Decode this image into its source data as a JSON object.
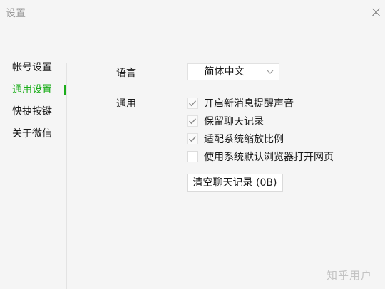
{
  "window": {
    "title": "设置"
  },
  "sidebar": {
    "items": [
      {
        "label": "帐号设置",
        "active": false
      },
      {
        "label": "通用设置",
        "active": true
      },
      {
        "label": "快捷按键",
        "active": false
      },
      {
        "label": "关于微信",
        "active": false
      }
    ]
  },
  "settings": {
    "language_label": "语言",
    "language_value": "简体中文",
    "general_label": "通用",
    "options": [
      {
        "label": "开启新消息提醒声音",
        "checked": true
      },
      {
        "label": "保留聊天记录",
        "checked": true
      },
      {
        "label": "适配系统缩放比例",
        "checked": true
      },
      {
        "label": "使用系统默认浏览器打开网页",
        "checked": false
      }
    ],
    "clear_button_label": "清空聊天记录 (0B)"
  },
  "watermark": "知乎用户",
  "colors": {
    "accent": "#1aad19",
    "check": "#8a8a8a",
    "background": "#f5f5f5"
  },
  "icons": {
    "minimize": "minimize-icon",
    "close": "close-icon",
    "dropdown": "chevron-down-icon",
    "check": "checkmark-icon"
  }
}
